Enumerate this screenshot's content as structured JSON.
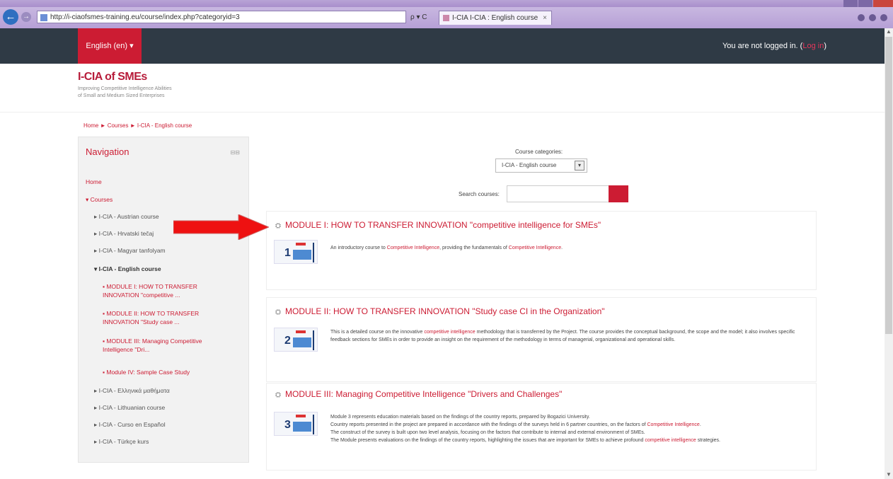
{
  "browser": {
    "url": "http://i-ciaofsmes-training.eu/course/index.php?categoryid=3",
    "search_controls": "ρ ▾ C",
    "tab_title": "I-CIA I-CIA : English course",
    "tab_close": "×"
  },
  "navbar": {
    "language": "English (en) ▾",
    "login_text": "You are not logged in. (",
    "login_link": "Log in",
    "login_close": ")"
  },
  "header": {
    "logo_title": "I-CIA of SMEs",
    "logo_sub1": "Improving Competitive Intelligence Abilities",
    "logo_sub2": "of Small and Medium Sized Enterprises"
  },
  "breadcrumb": "Home ► Courses ► I-CIA - English course",
  "sidebar": {
    "title": "Navigation",
    "dock": "⊟⊟",
    "items": [
      {
        "label": "Home"
      },
      {
        "label": "▾ Courses"
      },
      {
        "label": "▸ I-CIA - Austrian course"
      },
      {
        "label": "▸ I-CIA - Hrvatski tečaj"
      },
      {
        "label": "▸ I-CIA - Magyar tanfolyam"
      },
      {
        "label": "▾ I-CIA - English course"
      },
      {
        "label": "▪ MODULE I: HOW TO TRANSFER INNOVATION \"competitive ..."
      },
      {
        "label": "▪ MODULE II: HOW TO TRANSFER INNOVATION \"Study case ..."
      },
      {
        "label": "▪ MODULE III: Managing Competitive Intelligence \"Dri..."
      },
      {
        "label": "▪ Module IV: Sample Case Study"
      },
      {
        "label": "▸ I-CIA - Ελληνικά μαθήματα"
      },
      {
        "label": "▸ I-CIA - Lithuanian course"
      },
      {
        "label": "▸ I-CIA - Curso en Español"
      },
      {
        "label": "▸ I-CIA - Türkçe kurs"
      }
    ]
  },
  "filters": {
    "category_label": "Course categories:",
    "category_value": "I-CIA - English course",
    "search_label": "Search courses:"
  },
  "courses": [
    {
      "title": "MODULE I: HOW TO TRANSFER INNOVATION \"competitive intelligence for SMEs\"",
      "num": "1",
      "summary_a": "An introductory course to ",
      "summary_hl1": "Competitive Intelligence",
      "summary_b": ", providing the fundamentals of ",
      "summary_hl2": "Competitive Intelligence",
      "summary_c": "."
    },
    {
      "title": "MODULE II: HOW TO TRANSFER INNOVATION \"Study case CI in the Organization\"",
      "num": "2",
      "summary_a": "This is a detailed course on the innovative ",
      "summary_hl1": "competitive intelligence",
      "summary_b": " methodology that is transferred by the Project. The course provides the conceptual background, the scope and the model; it also involves specific feedback sections for SMEs in order to provide an insight on the requirement of the methodology in terms of managerial, organizational and operational skills."
    },
    {
      "title": "MODULE III: Managing Competitive Intelligence \"Drivers and Challenges\"",
      "num": "3",
      "line1": "Module 3 represents education materials based on the findings of the country reports, prepared by Bogazici University.",
      "line2a": "Country reports presented in the project are prepared in accordance with the findings of the surveys held in 6 partner countries, on the factors of ",
      "line2hl": "Competitive Intelligence",
      "line2b": ".",
      "line3": "The construct of the survey is built upon two level analysis, focusing on the factors that contribute to internal and external environment of SMEs.",
      "line4a": "The Module presents evaluations on the findings of the country reports, highlighting the issues that are important for SMEs to achieve profound ",
      "line4hl": "competitive intelligence",
      "line4b": " strategies."
    }
  ],
  "colors": {
    "accent": "#cc1c33",
    "navbar": "#2f3a45",
    "arrow": "#ee1111"
  }
}
